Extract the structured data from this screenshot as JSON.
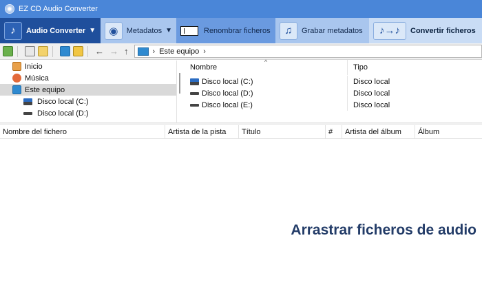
{
  "window": {
    "title": "EZ CD Audio Converter"
  },
  "ribbon": {
    "audio_converter": "Audio Converter",
    "metadatos": "Metadatos",
    "renombrar": "Renombrar ficheros",
    "grabar": "Grabar metadatos",
    "convertir": "Convertir ficheros"
  },
  "address": {
    "location": "Este equipo"
  },
  "tree": {
    "items": [
      {
        "label": "Inicio"
      },
      {
        "label": "Música"
      },
      {
        "label": "Este equipo"
      },
      {
        "label": "Disco local (C:)"
      },
      {
        "label": "Disco local (D:)"
      }
    ]
  },
  "filelist": {
    "columns": [
      "Nombre",
      "Tipo"
    ],
    "rows": [
      {
        "name": "Disco local (C:)",
        "type": "Disco local"
      },
      {
        "name": "Disco local (D:)",
        "type": "Disco local"
      },
      {
        "name": "Disco local (E:)",
        "type": "Disco local"
      }
    ]
  },
  "tracks": {
    "columns": [
      "Nombre del fichero",
      "Artista de la pista",
      "Título",
      "#",
      "Artista del álbum",
      "Álbum"
    ]
  },
  "dropzone": {
    "text": "Arrastrar ficheros de audio"
  },
  "colors": {
    "titlebar": "#4a86d8",
    "ribbon": "#5b90dc",
    "active": "#1f4f9c",
    "drop_text": "#233c68"
  }
}
